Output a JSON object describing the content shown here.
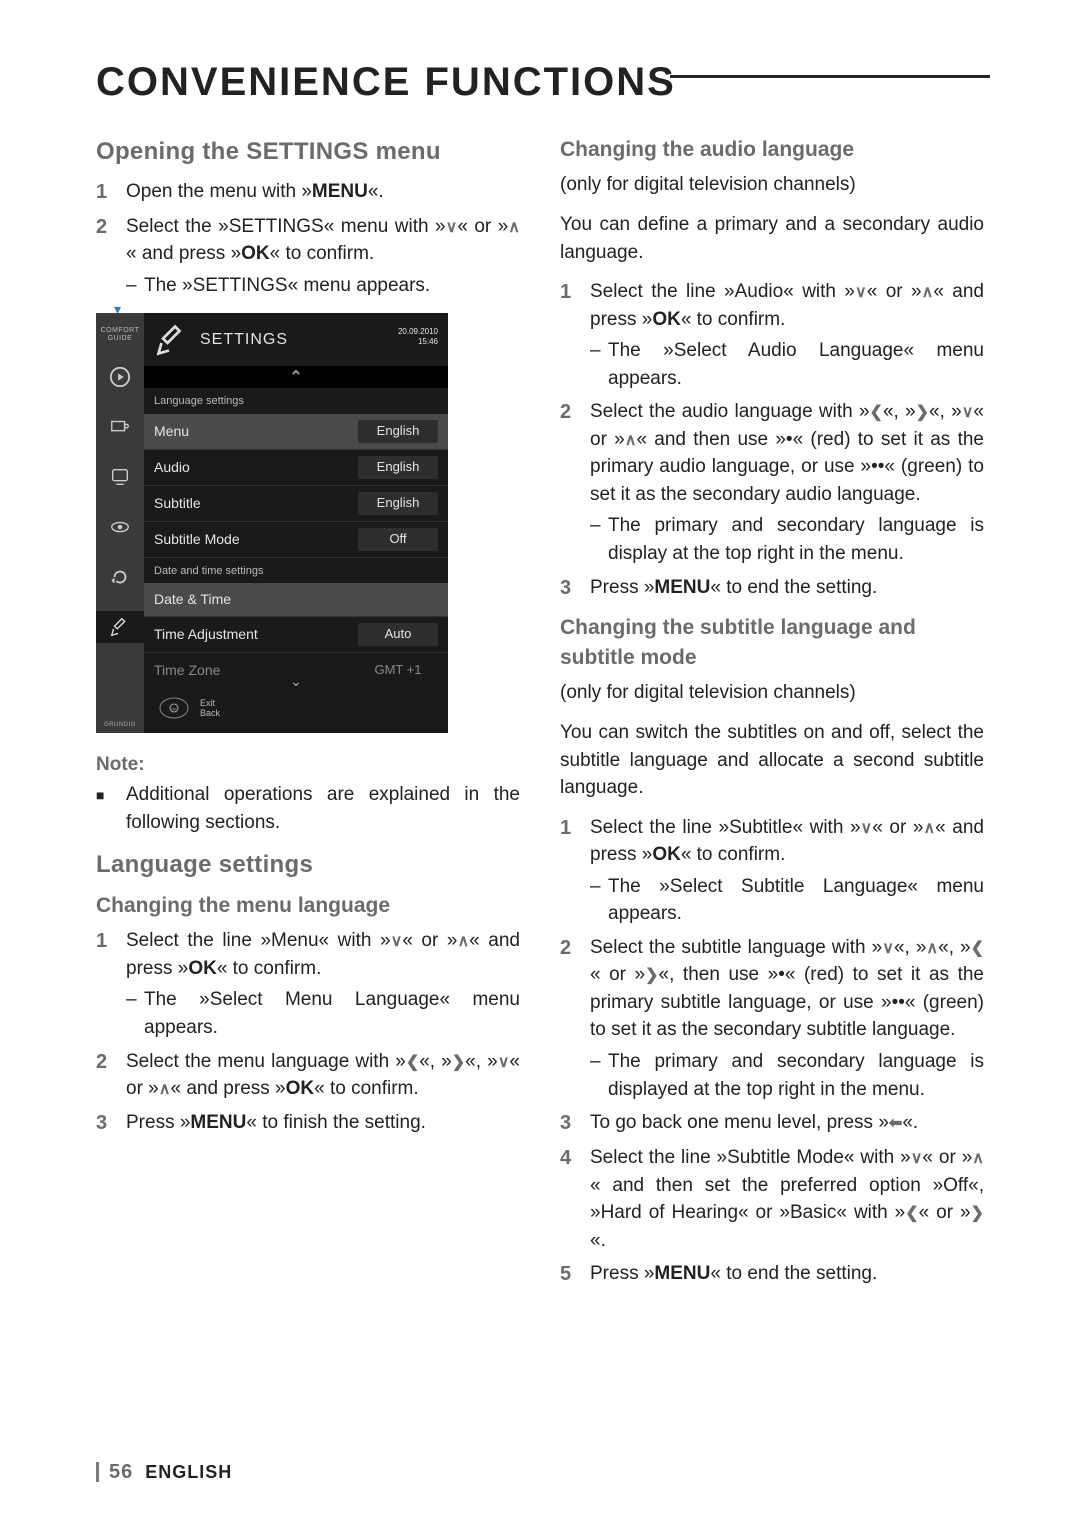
{
  "page_title": "CONVENIENCE FUNCTIONS",
  "left": {
    "h_open": "Opening the SETTINGS menu",
    "s1": {
      "n": "1",
      "t1": "Open the menu with »",
      "menu": "MENU",
      "t2": "«."
    },
    "s2": {
      "n": "2",
      "t1": "Select the »SETTINGS« menu with »",
      "t2": "« or »",
      "t3": "« and press »",
      "ok": "OK",
      "t4": "« to confirm.",
      "sub": "The »SETTINGS« menu appears."
    },
    "note_label": "Note:",
    "note_body": "Additional operations are explained in the following sections.",
    "h_lang": "Language settings",
    "h_menu_lang": "Changing the menu language",
    "ml1": {
      "n": "1",
      "t1": "Select the line »Menu« with »",
      "t2": "« or »",
      "t3": "« and press »",
      "ok": "OK",
      "t4": "« to confirm.",
      "sub": "The »Select Menu Language« menu appears."
    },
    "ml2": {
      "n": "2",
      "t1": "Select the menu language with »",
      "t2": "«, »",
      "t3": "«, »",
      "t4": "« or »",
      "t5": "« and press »",
      "ok": "OK",
      "t6": "« to confirm."
    },
    "ml3": {
      "n": "3",
      "t1": "Press »",
      "menu": "MENU",
      "t2": "« to finish the setting."
    }
  },
  "right": {
    "h_audio": "Changing the audio language",
    "audio_note": "(only for digital television channels)",
    "audio_intro": "You can define a primary and a secondary audio language.",
    "a1": {
      "n": "1",
      "t1": "Select the line »Audio« with »",
      "t2": "« or »",
      "t3": "« and press »",
      "ok": "OK",
      "t4": "« to confirm.",
      "sub": "The »Select Audio Language« menu appears."
    },
    "a2": {
      "n": "2",
      "t1": "Select the audio language with »",
      "t2": "«, »",
      "t3": "«, »",
      "t4": "« or »",
      "t5": "« and then use »",
      "red": "•",
      "t6": "« (red) to set it as the primary audio language, or use »",
      "green": "••",
      "t7": "« (green) to set it as the secondary audio language.",
      "sub": "The primary and secondary language is display at the top right in the menu."
    },
    "a3": {
      "n": "3",
      "t1": "Press »",
      "menu": "MENU",
      "t2": "« to end the setting."
    },
    "h_sub": "Changing the subtitle language and subtitle mode",
    "sub_note": "(only for digital television channels)",
    "sub_intro": "You can switch the subtitles on and off, select the subtitle language and allocate a second subtitle language.",
    "su1": {
      "n": "1",
      "t1": "Select the line »Subtitle« with »",
      "t2": "« or »",
      "t3": "« and press »",
      "ok": "OK",
      "t4": "« to confirm.",
      "sub": "The »Select Subtitle Language« menu appears."
    },
    "su2": {
      "n": "2",
      "t1": "Select the subtitle language with »",
      "t2": "«, »",
      "t3": "«, »",
      "t4": "« or »",
      "t5": "«, then use »",
      "red": "•",
      "t6": "« (red) to set it as the primary subtitle language, or use »",
      "green": "••",
      "t7": "« (green) to set it as the secondary subtitle language.",
      "sub": "The primary and secondary language is displayed at the top right in the menu."
    },
    "su3": {
      "n": "3",
      "t1": "To go back one menu level, press »",
      "t2": "«."
    },
    "su4": {
      "n": "4",
      "t1": "Select the line »Subtitle Mode« with »",
      "t2": "« or »",
      "t3": "« and then set the preferred option »Off«, »Hard of Hearing« or »Basic« with »",
      "t4": "« or »",
      "t5": "«."
    },
    "su5": {
      "n": "5",
      "t1": "Press »",
      "menu": "MENU",
      "t2": "« to end the setting."
    }
  },
  "osd": {
    "brand1": "COMFORT",
    "brand2": "GUIDE",
    "title": "SETTINGS",
    "date": "20.09.2010",
    "time": "15:46",
    "sec1": "Language settings",
    "rows1": [
      {
        "label": "Menu",
        "value": "English",
        "hl": true
      },
      {
        "label": "Audio",
        "value": "English"
      },
      {
        "label": "Subtitle",
        "value": "English"
      },
      {
        "label": "Subtitle Mode",
        "value": "Off"
      }
    ],
    "sec2": "Date and time settings",
    "rows2": [
      {
        "label": "Date & Time",
        "value": "",
        "hl": true,
        "plain": true
      },
      {
        "label": "Time Adjustment",
        "value": "Auto"
      },
      {
        "label": "Time Zone",
        "value": "GMT +1",
        "plain": true,
        "nounder": true
      }
    ],
    "footer1": "Exit",
    "footer2": "Back",
    "grundig": "GRUNDIG"
  },
  "footer": {
    "page": "56",
    "lang": "ENGLISH"
  }
}
